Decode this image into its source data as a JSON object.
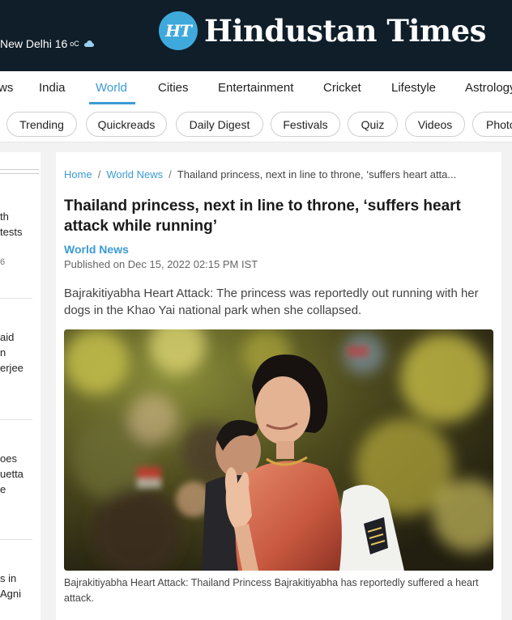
{
  "header": {
    "weather_city": "New Delhi 16",
    "weather_unit": "oC",
    "logo_badge": "HT",
    "logo_text": "Hindustan Times"
  },
  "nav": {
    "items": [
      "ws",
      "India",
      "World",
      "Cities",
      "Entertainment",
      "Cricket",
      "Lifestyle",
      "Astrology"
    ],
    "active": "World"
  },
  "chips": [
    "Trending",
    "Quickreads",
    "Daily Digest",
    "Festivals",
    "Quiz",
    "Videos",
    "Photo"
  ],
  "rail": {
    "items": [
      {
        "line1": "th",
        "line2": "tests",
        "meta": "6"
      },
      {
        "line1": "aid",
        "line2": "n",
        "line3": "erjee"
      },
      {
        "line1": "oes",
        "line2": "uetta",
        "line3": "e"
      },
      {
        "line1": "s in",
        "line2": "Agni"
      }
    ]
  },
  "article": {
    "breadcrumb": {
      "home": "Home",
      "section": "World News",
      "current": "Thailand princess, next in line to throne, ‘suffers heart atta..."
    },
    "headline": "Thailand princess, next in line to throne, ‘suffers heart attack while running’",
    "section_tag": "World News",
    "published": "Published on Dec 15, 2022 02:15 PM IST",
    "summary": "Bajrakitiyabha Heart Attack: The princess was reportedly out running with her dogs in the Khao Yai national park when she collapsed.",
    "caption": "Bajrakitiyabha Heart Attack: Thailand Princess Bajrakitiyabha has reportedly suffered a heart attack."
  },
  "colors": {
    "header_bg": "#0f1e29",
    "accent": "#3a9bd5",
    "logo_badge": "#3fa9dc"
  }
}
